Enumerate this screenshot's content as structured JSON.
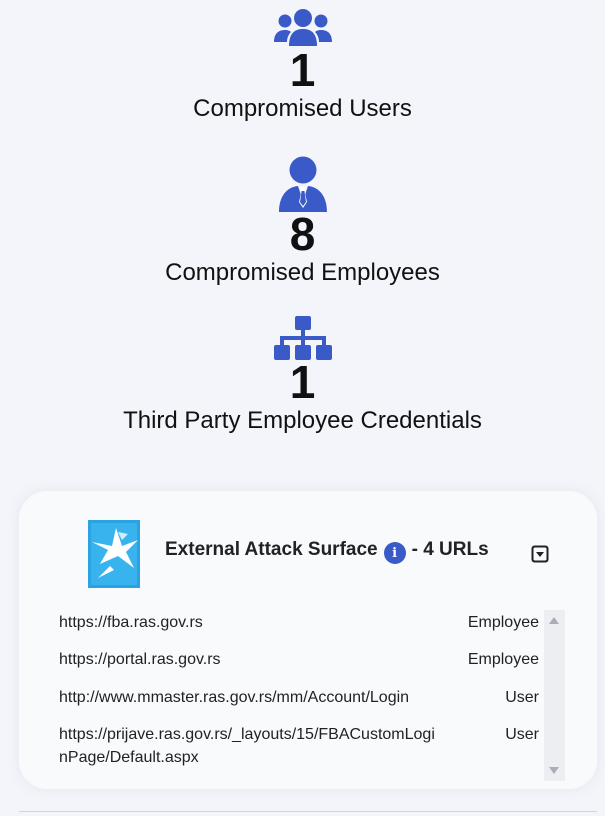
{
  "stats": [
    {
      "icon": "users-icon",
      "value": "1",
      "label": "Compromised Users"
    },
    {
      "icon": "employee-icon",
      "value": "8",
      "label": "Compromised Employees"
    },
    {
      "icon": "sitemap-icon",
      "value": "1",
      "label": "Third Party Employee Credentials"
    }
  ],
  "attack_surface": {
    "title": "External Attack Surface",
    "info_icon": "i",
    "count_text": "- 4 URLs",
    "rows": [
      {
        "url": "https://fba.ras.gov.rs",
        "role": "Employee"
      },
      {
        "url": "https://portal.ras.gov.rs",
        "role": "Employee"
      },
      {
        "url": "http://www.mmaster.ras.gov.rs/mm/Account/Login",
        "role": "User"
      },
      {
        "url": "https://prijave.ras.gov.rs/_layouts/15/FBACustomLoginPage/Default.aspx",
        "role": "User"
      }
    ]
  },
  "colors": {
    "accent": "#3a5bc7",
    "background": "#f4f5fa",
    "card": "#f9fafc"
  }
}
